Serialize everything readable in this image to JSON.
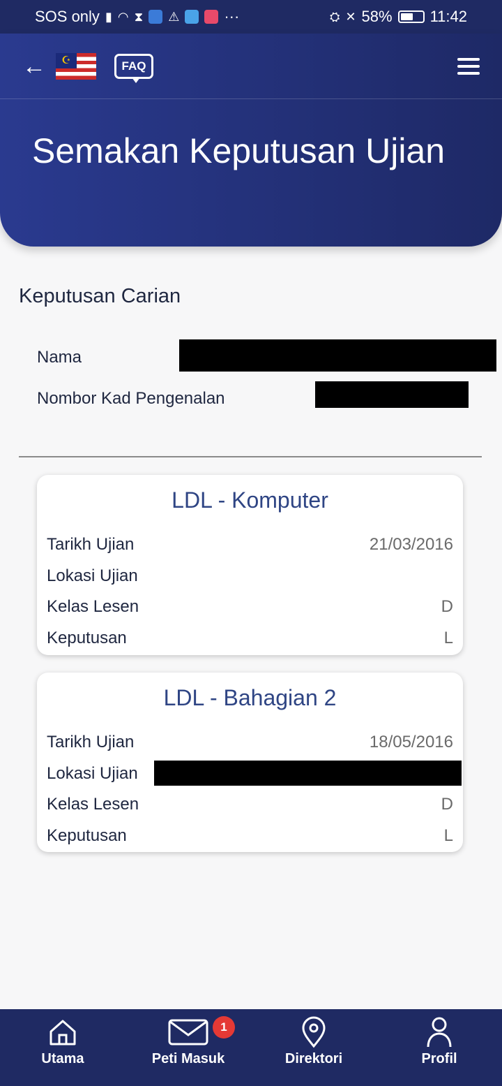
{
  "status_bar": {
    "carrier": "SOS only",
    "more_indicator": "···",
    "battery_percent_text": "58%",
    "battery_fraction": 0.58,
    "time": "11:42"
  },
  "header": {
    "title": "Semakan Keputusan Ujian",
    "faq_label": "FAQ",
    "flag_icon": "malaysia-flag-icon",
    "back_icon": "back-arrow-icon",
    "menu_icon": "hamburger-menu-icon"
  },
  "search_result": {
    "title": "Keputusan Carian",
    "name_label": "Nama",
    "ic_label": "Nombor Kad Pengenalan"
  },
  "cards": [
    {
      "title": "LDL - Komputer",
      "rows": [
        {
          "label": "Tarikh Ujian",
          "value": "21/03/2016"
        },
        {
          "label": "Lokasi Ujian",
          "value": ""
        },
        {
          "label": "Kelas Lesen",
          "value": "D"
        },
        {
          "label": "Keputusan",
          "value": "L"
        }
      ]
    },
    {
      "title": "LDL - Bahagian 2",
      "rows": [
        {
          "label": "Tarikh Ujian",
          "value": "18/05/2016"
        },
        {
          "label": "Lokasi Ujian",
          "value": ""
        },
        {
          "label": "Kelas Lesen",
          "value": "D"
        },
        {
          "label": "Keputusan",
          "value": "L"
        }
      ]
    }
  ],
  "bottom_nav": {
    "items": [
      {
        "label": "Utama",
        "icon": "home-icon"
      },
      {
        "label": "Peti Masuk",
        "icon": "mail-icon",
        "badge": "1"
      },
      {
        "label": "Direktori",
        "icon": "location-pin-icon"
      },
      {
        "label": "Profil",
        "icon": "person-icon"
      }
    ]
  },
  "colors": {
    "header_start": "#2a3a8f",
    "header_end": "#1e2966",
    "nav_bg": "#1f2a63",
    "card_title": "#2f4584",
    "badge": "#e53935"
  }
}
